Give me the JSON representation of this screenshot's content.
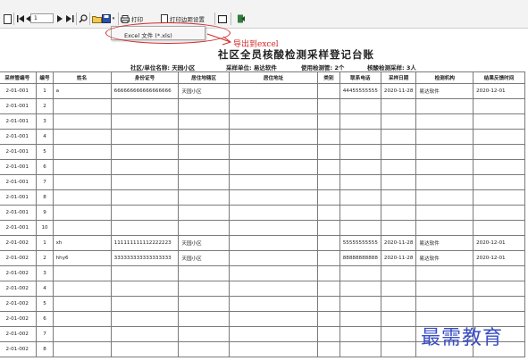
{
  "toolbar": {
    "page_value": "1",
    "print_label": "打印",
    "print_setup_label": "打印边距设置",
    "icons": [
      "document-icon",
      "first-page-icon",
      "prev-page-icon",
      "next-page-icon",
      "last-page-icon",
      "search-icon",
      "open-folder-icon",
      "save-icon",
      "printer-icon",
      "page-icon",
      "window-icon",
      "exit-icon"
    ]
  },
  "export_menu": {
    "item_label": "Excel 文件 (*.xls)"
  },
  "annotation": {
    "label": "导出到excel",
    "color": "#d42a2a"
  },
  "report": {
    "title": "社区全员核酸检测采样登记台账",
    "community_label": "社区/单位名称: 天园小区",
    "sampling_unit_label": "采样单位: 易达软件",
    "tubes_used_label": "使用检测管: 2个",
    "sampled_count_label": "核酸检测采样: 3人"
  },
  "table": {
    "columns": [
      "采样管编号",
      "编号",
      "姓名",
      "身份证号",
      "居住地辖区",
      "居住地址",
      "类别",
      "联系电话",
      "采样日期",
      "检测机构",
      "结果反馈时间"
    ],
    "rows": [
      [
        "2-01-001",
        "1",
        "a",
        "666666666666666666",
        "天园小区",
        "",
        "",
        "44455555555",
        "2020-11-28",
        "易达软件",
        "2020-12-01"
      ],
      [
        "2-01-001",
        "2",
        "",
        "",
        "",
        "",
        "",
        "",
        "",
        "",
        ""
      ],
      [
        "2-01-001",
        "3",
        "",
        "",
        "",
        "",
        "",
        "",
        "",
        "",
        ""
      ],
      [
        "2-01-001",
        "4",
        "",
        "",
        "",
        "",
        "",
        "",
        "",
        "",
        ""
      ],
      [
        "2-01-001",
        "5",
        "",
        "",
        "",
        "",
        "",
        "",
        "",
        "",
        ""
      ],
      [
        "2-01-001",
        "6",
        "",
        "",
        "",
        "",
        "",
        "",
        "",
        "",
        ""
      ],
      [
        "2-01-001",
        "7",
        "",
        "",
        "",
        "",
        "",
        "",
        "",
        "",
        ""
      ],
      [
        "2-01-001",
        "8",
        "",
        "",
        "",
        "",
        "",
        "",
        "",
        "",
        ""
      ],
      [
        "2-01-001",
        "9",
        "",
        "",
        "",
        "",
        "",
        "",
        "",
        "",
        ""
      ],
      [
        "2-01-001",
        "10",
        "",
        "",
        "",
        "",
        "",
        "",
        "",
        "",
        ""
      ],
      [
        "2-01-002",
        "1",
        "xh",
        "111111111112222223",
        "天园小区",
        "",
        "",
        "55555555555",
        "2020-11-28",
        "易达软件",
        "2020-12-01"
      ],
      [
        "2-01-002",
        "2",
        "hhy6",
        "333333333333333333",
        "天园小区",
        "",
        "",
        "88888888888",
        "2020-11-28",
        "易达软件",
        "2020-12-01"
      ],
      [
        "2-01-002",
        "3",
        "",
        "",
        "",
        "",
        "",
        "",
        "",
        "",
        ""
      ],
      [
        "2-01-002",
        "4",
        "",
        "",
        "",
        "",
        "",
        "",
        "",
        "",
        ""
      ],
      [
        "2-01-002",
        "5",
        "",
        "",
        "",
        "",
        "",
        "",
        "",
        "",
        ""
      ],
      [
        "2-01-002",
        "6",
        "",
        "",
        "",
        "",
        "",
        "",
        "",
        "",
        ""
      ],
      [
        "2-01-002",
        "7",
        "",
        "",
        "",
        "",
        "",
        "",
        "",
        "",
        ""
      ],
      [
        "2-01-002",
        "8",
        "",
        "",
        "",
        "",
        "",
        "",
        "",
        "",
        ""
      ]
    ]
  },
  "watermark": {
    "text": "最需教育",
    "color": "#3a4ec4"
  }
}
